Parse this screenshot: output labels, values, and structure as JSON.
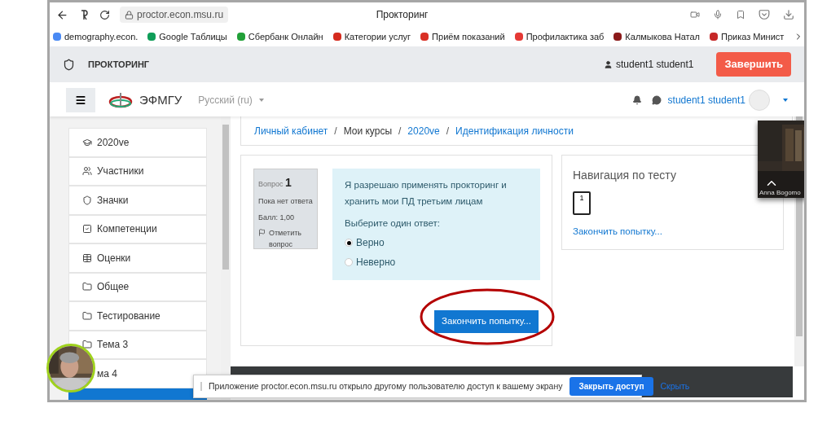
{
  "browser": {
    "url": "proctor.econ.msu.ru",
    "title": "Прокторинг",
    "bookmarks": [
      {
        "label": "demography.econ."
      },
      {
        "label": "Google Таблицы"
      },
      {
        "label": "Сбербанк Онлайн"
      },
      {
        "label": "Категории услуг"
      },
      {
        "label": "Приём показаний"
      },
      {
        "label": "Профилактика заб"
      },
      {
        "label": "Калмыкова Натал"
      },
      {
        "label": "Приказ Минист"
      }
    ]
  },
  "proctoring": {
    "title": "ПРОКТОРИНГ",
    "user": "student1 student1",
    "finish_button": "Завершить"
  },
  "navbar": {
    "site_name": "ЭФМГУ",
    "language": "Русский (ru)",
    "user": "student1 student1"
  },
  "sidebar": {
    "items": [
      {
        "label": "2020ve"
      },
      {
        "label": "Участники"
      },
      {
        "label": "Значки"
      },
      {
        "label": "Компетенции"
      },
      {
        "label": "Оценки"
      },
      {
        "label": "Общее"
      },
      {
        "label": "Тестирование"
      },
      {
        "label": "Тема 3"
      },
      {
        "label": "ма 4"
      }
    ]
  },
  "breadcrumb": [
    {
      "label": "Личный кабинет",
      "link": true
    },
    {
      "separator": "/",
      "label": "Мои курсы",
      "link": false
    },
    {
      "separator": "/",
      "label": "2020ve",
      "link": true
    },
    {
      "separator": "/",
      "label": "Идентификация личности",
      "link": true
    }
  ],
  "question": {
    "label": "Вопрос",
    "number": "1",
    "status": "Пока нет ответа",
    "grade": "Балл: 1,00",
    "flag": "Отметить вопрос",
    "text": "Я разрешаю применять прокторинг и хранить мои ПД третьим лицам",
    "prompt": "Выберите один ответ:",
    "options": [
      {
        "label": "Верно",
        "selected": true
      },
      {
        "label": "Неверно",
        "selected": false
      }
    ],
    "finish_button": "Закончить попытку..."
  },
  "quiz_navigation": {
    "title": "Навигация по тесту",
    "questions": [
      "1"
    ],
    "finish_link": "Закончить попытку..."
  },
  "video_tile": {
    "caption": "Anna Bogomo"
  },
  "share_notice": {
    "text": "Приложение proctor.econ.msu.ru открыло другому пользователю доступ к вашему экрану",
    "stop_button": "Закрыть доступ",
    "hide_link": "Скрыть"
  }
}
